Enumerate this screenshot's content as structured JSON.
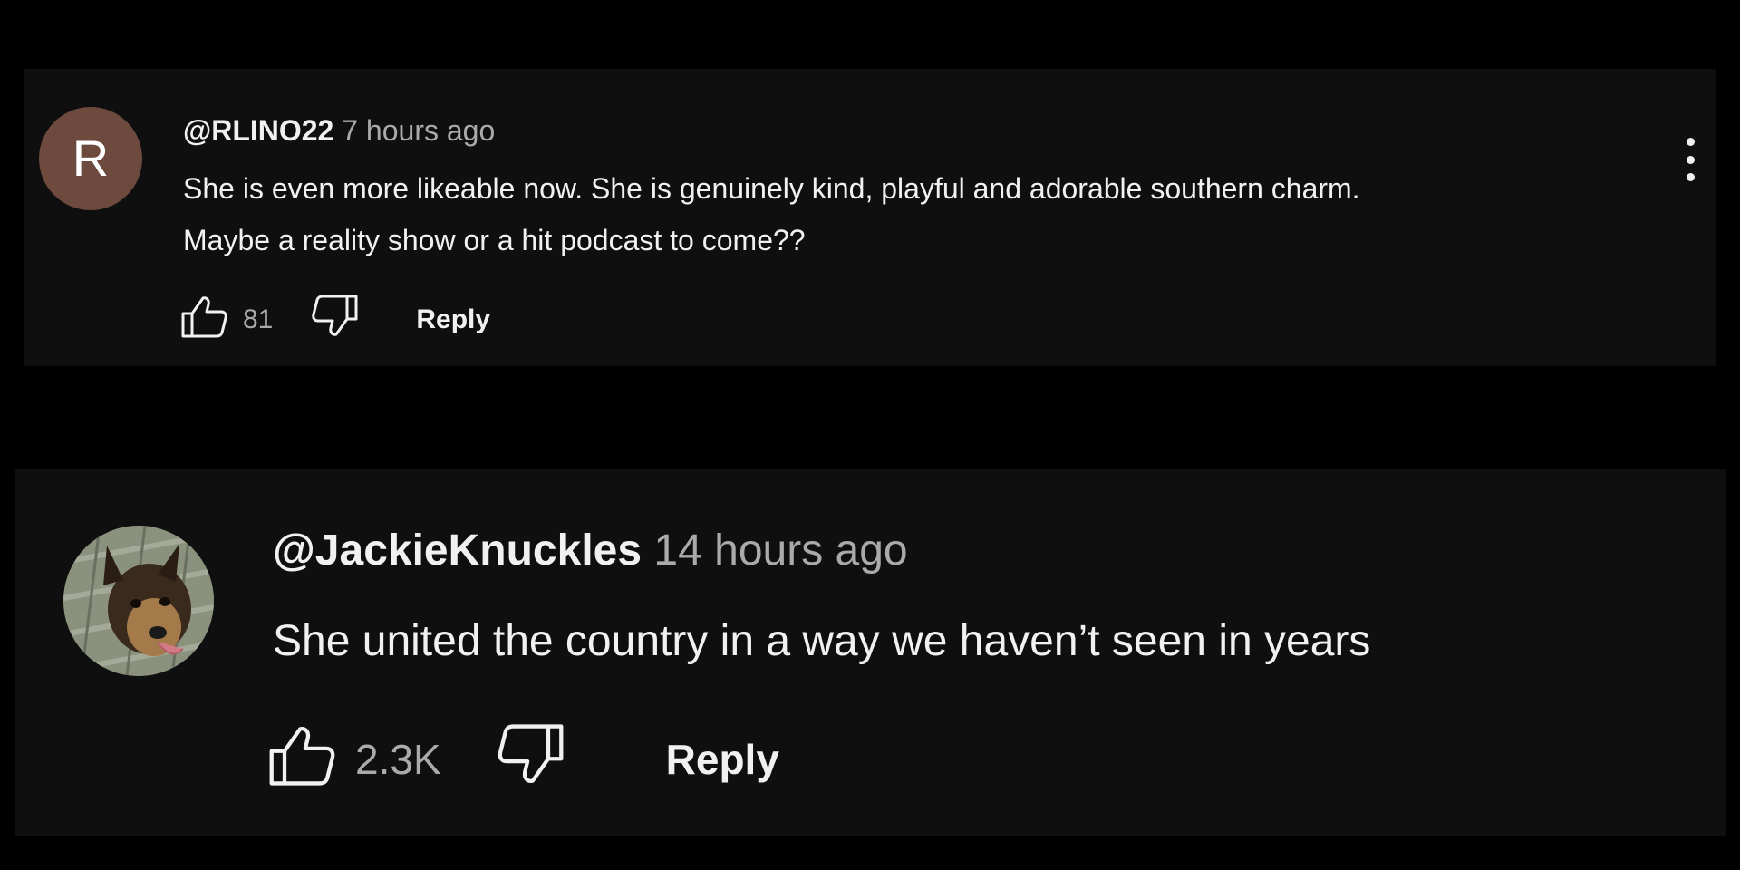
{
  "comments": [
    {
      "avatar_letter": "R",
      "avatar_color": "#6e4a3e",
      "handle": "@RLINO22",
      "time": "7 hours ago",
      "text_line1": "She is even more likeable now. She is genuinely kind, playful and adorable southern charm.",
      "text_line2": "Maybe a reality show or a hit podcast to come??",
      "likes": "81",
      "reply_label": "Reply"
    },
    {
      "handle": "@JackieKnuckles",
      "time": "14 hours ago",
      "text_line1": "She united the country in a way we haven’t seen in years",
      "likes": "2.3K",
      "reply_label": "Reply"
    }
  ],
  "colors": {
    "background": "#000000",
    "panel": "#0f0f0f",
    "text": "#f1f1f1",
    "muted": "#aaaaaa"
  },
  "icons": [
    "thumbs-up-icon",
    "thumbs-down-icon",
    "more-vert-icon"
  ]
}
